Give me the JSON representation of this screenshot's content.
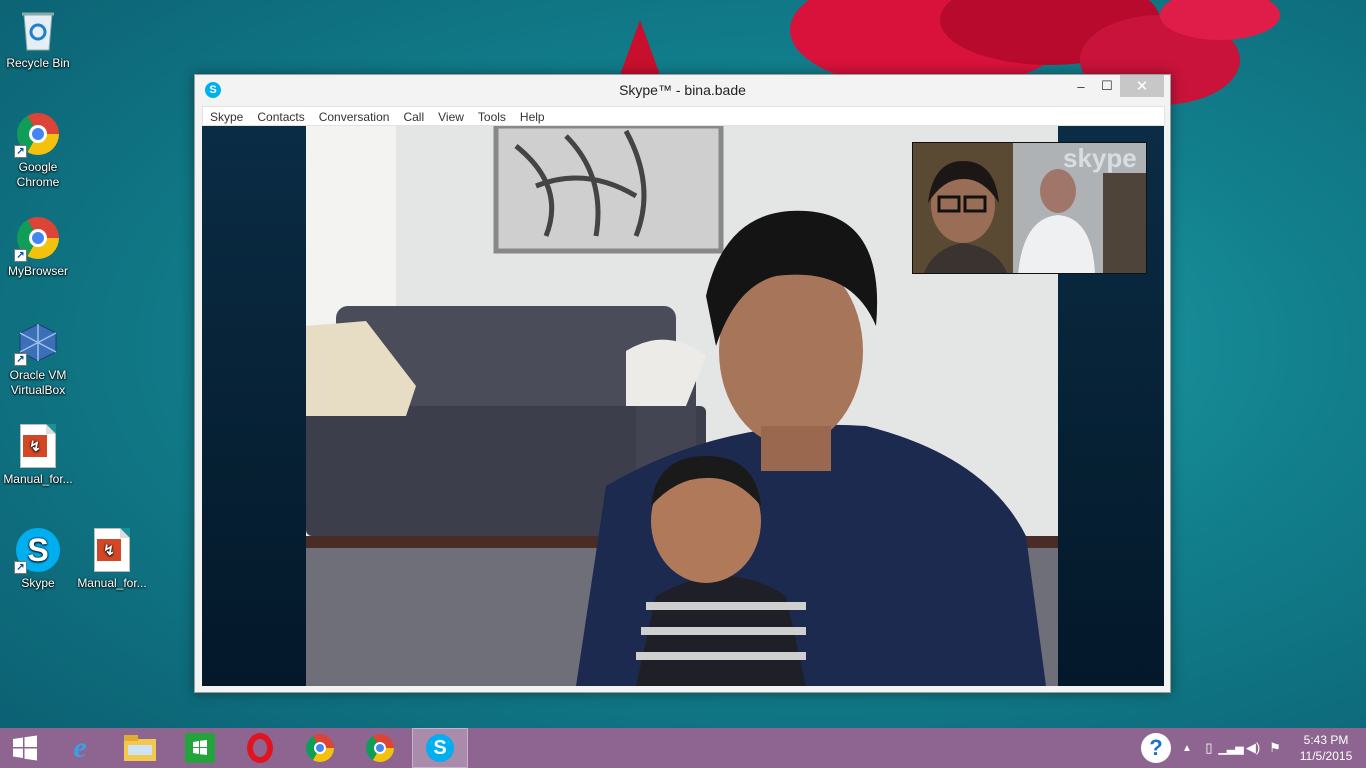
{
  "desktop": {
    "icons": [
      {
        "label": "Recycle Bin",
        "icon": "recycle-bin-icon"
      },
      {
        "label": "Google\nChrome",
        "icon": "chrome-icon"
      },
      {
        "label": "MyBrowser",
        "icon": "chrome-icon"
      },
      {
        "label": "Oracle VM\nVirtualBox",
        "icon": "virtualbox-icon"
      },
      {
        "label": "Manual_for...",
        "icon": "document-icon"
      },
      {
        "label": "Skype",
        "icon": "skype-icon"
      },
      {
        "label": "Manual_for...",
        "icon": "document-icon"
      }
    ]
  },
  "window": {
    "title": "Skype™ - bina.bade",
    "controls": {
      "minimize": "–",
      "maximize": "☐",
      "close": "✕"
    },
    "menu": [
      "Skype",
      "Contacts",
      "Conversation",
      "Call",
      "View",
      "Tools",
      "Help"
    ],
    "self_view_watermark": "skype"
  },
  "taskbar": {
    "apps": [
      "start-icon",
      "internet-explorer-icon",
      "file-explorer-icon",
      "store-icon",
      "opera-icon",
      "chrome-icon",
      "chrome-icon",
      "skype-icon"
    ],
    "active_app": "skype-icon",
    "clock": {
      "time": "5:43 PM",
      "date": "11/5/2015"
    }
  },
  "colors": {
    "skype_blue": "#00aff0",
    "taskbar": "#8e6590",
    "desktop": "#127f8c"
  }
}
